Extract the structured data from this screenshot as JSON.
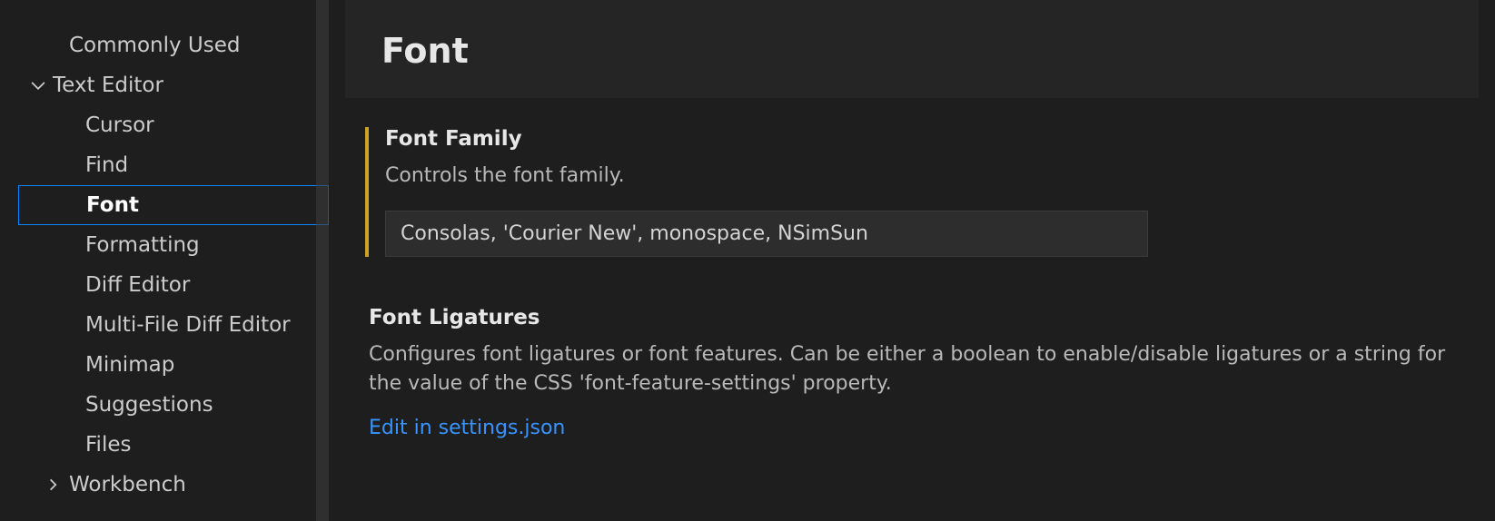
{
  "toc": {
    "commonly_used": "Commonly Used",
    "text_editor": "Text Editor",
    "cursor": "Cursor",
    "find": "Find",
    "font": "Font",
    "formatting": "Formatting",
    "diff_editor": "Diff Editor",
    "multi_file": "Multi-File Diff Editor",
    "minimap": "Minimap",
    "suggestions": "Suggestions",
    "files": "Files",
    "workbench": "Workbench"
  },
  "section": {
    "title": "Font"
  },
  "fontFamily": {
    "title": "Font Family",
    "desc": "Controls the font family.",
    "value": "Consolas, 'Courier New', monospace, NSimSun"
  },
  "fontLigatures": {
    "title": "Font Ligatures",
    "desc": "Configures font ligatures or font features. Can be either a boolean to enable/disable ligatures or a string for the value of the CSS 'font-feature-settings' property.",
    "link": "Edit in settings.json"
  }
}
